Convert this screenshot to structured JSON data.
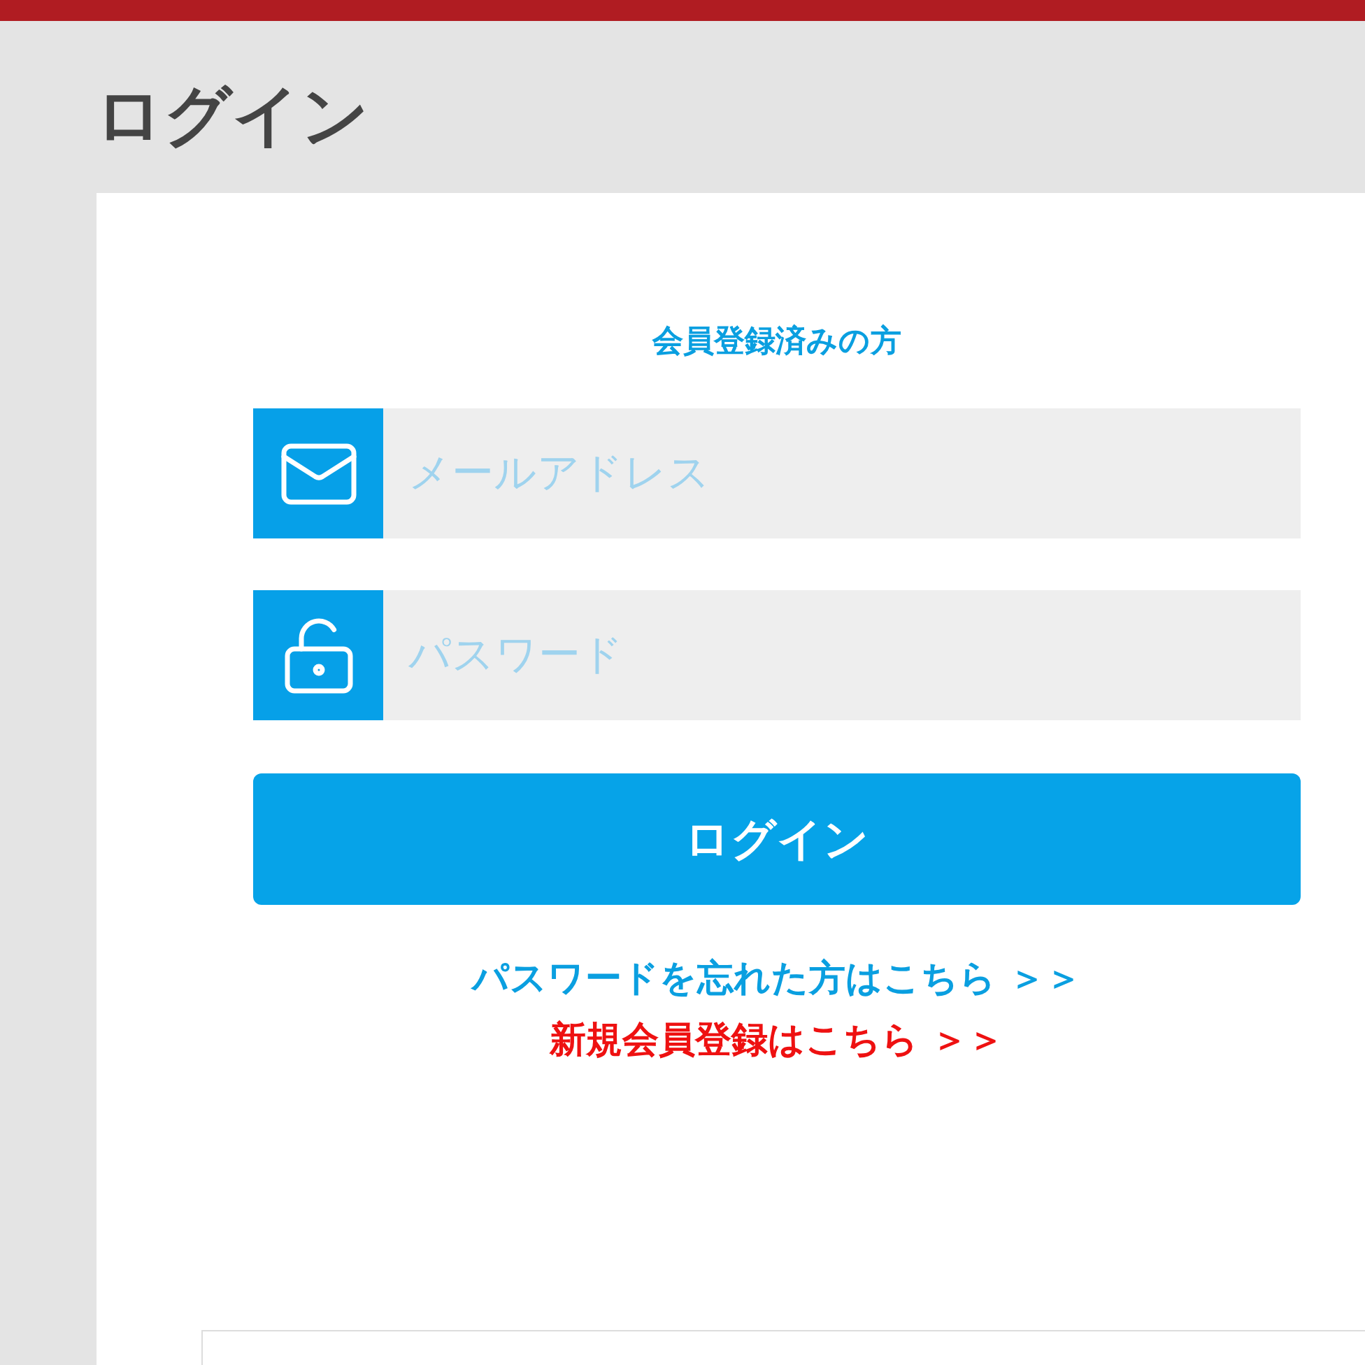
{
  "page_title": "ログイン",
  "section_heading": "会員登録済みの方",
  "fields": [
    {
      "kind": "email",
      "placeholder": "メールアドレス"
    },
    {
      "kind": "password",
      "placeholder": "パスワード"
    }
  ],
  "login_button": "ログイン",
  "links": [
    {
      "text": "パスワードを忘れた方はこちら ＞＞",
      "color": "#0a9fe0"
    },
    {
      "text": "新規会員登録はこちら ＞＞",
      "color": "#ee1111"
    }
  ]
}
